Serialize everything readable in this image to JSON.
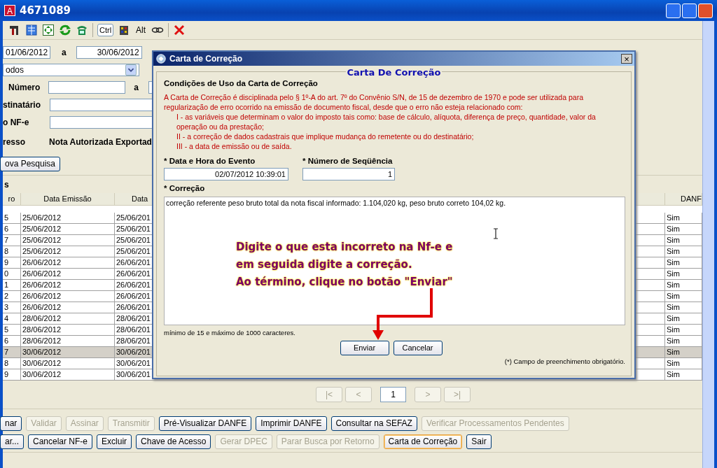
{
  "window": {
    "title": "4671089",
    "app_icon": "A"
  },
  "toolbar": {
    "keys": [
      "Ctrl",
      "Alt"
    ]
  },
  "filters": {
    "date_from": "01/06/2012",
    "date_sep": "a",
    "date_to": "30/06/2012",
    "select_value": "odos",
    "numero_label": "Número",
    "numero_sep": "a",
    "destinatario_label": "stinatário",
    "nfe_label": "o NF-e",
    "progress_label": "resso",
    "progress_value": "Nota Autorizada Exportad",
    "search_button": "ova Pesquisa"
  },
  "table": {
    "section_label": "s",
    "columns": [
      "ro",
      "Data Emissão",
      "Data",
      "DANF"
    ],
    "rows": [
      {
        "cells": [
          "5",
          "25/06/2012",
          "25/06/201",
          "Sim"
        ],
        "selected": false
      },
      {
        "cells": [
          "6",
          "25/06/2012",
          "25/06/201",
          "Sim"
        ],
        "selected": false
      },
      {
        "cells": [
          "7",
          "25/06/2012",
          "25/06/201",
          "Sim"
        ],
        "selected": false
      },
      {
        "cells": [
          "8",
          "25/06/2012",
          "25/06/201",
          "Sim"
        ],
        "selected": false
      },
      {
        "cells": [
          "9",
          "26/06/2012",
          "26/06/201",
          "Sim"
        ],
        "selected": false
      },
      {
        "cells": [
          "0",
          "26/06/2012",
          "26/06/201",
          "Sim"
        ],
        "selected": false
      },
      {
        "cells": [
          "1",
          "26/06/2012",
          "26/06/201",
          "Sim"
        ],
        "selected": false
      },
      {
        "cells": [
          "2",
          "26/06/2012",
          "26/06/201",
          "Sim"
        ],
        "selected": false
      },
      {
        "cells": [
          "3",
          "26/06/2012",
          "26/06/201",
          "Sim"
        ],
        "selected": false
      },
      {
        "cells": [
          "4",
          "28/06/2012",
          "28/06/201",
          "Sim"
        ],
        "selected": false
      },
      {
        "cells": [
          "5",
          "28/06/2012",
          "28/06/201",
          "Sim"
        ],
        "selected": false
      },
      {
        "cells": [
          "6",
          "28/06/2012",
          "28/06/201",
          "Sim"
        ],
        "selected": false
      },
      {
        "cells": [
          "7",
          "30/06/2012",
          "30/06/201",
          "Sim"
        ],
        "selected": true
      },
      {
        "cells": [
          "8",
          "30/06/2012",
          "30/06/201",
          "Sim"
        ],
        "selected": false
      },
      {
        "cells": [
          "9",
          "30/06/2012",
          "30/06/201",
          "Sim"
        ],
        "selected": false
      }
    ]
  },
  "pager": {
    "first": "|<",
    "prev": "<",
    "page": "1",
    "next": ">",
    "last": ">|"
  },
  "actions": [
    [
      {
        "label": "nar",
        "disabled": false,
        "focused": false
      },
      {
        "label": "Validar",
        "disabled": true,
        "focused": false
      },
      {
        "label": "Assinar",
        "disabled": true,
        "focused": false
      },
      {
        "label": "Transmitir",
        "disabled": true,
        "focused": false
      },
      {
        "label": "Pré-Visualizar DANFE",
        "disabled": false,
        "focused": false
      },
      {
        "label": "Imprimir DANFE",
        "disabled": false,
        "focused": false
      },
      {
        "label": "Consultar na SEFAZ",
        "disabled": false,
        "focused": false
      },
      {
        "label": "Verificar Processamentos Pendentes",
        "disabled": true,
        "focused": false
      }
    ],
    [
      {
        "label": "ar...",
        "disabled": false,
        "focused": false
      },
      {
        "label": "Cancelar NF-e",
        "disabled": false,
        "focused": false
      },
      {
        "label": "Excluir",
        "disabled": false,
        "focused": false
      },
      {
        "label": "Chave de Acesso",
        "disabled": false,
        "focused": false
      },
      {
        "label": "Gerar DPEC",
        "disabled": true,
        "focused": false
      },
      {
        "label": "Parar Busca por Retorno",
        "disabled": true,
        "focused": false
      },
      {
        "label": "Carta de Correção",
        "disabled": false,
        "focused": true
      },
      {
        "label": "Sair",
        "disabled": false,
        "focused": false
      }
    ]
  ],
  "dialog": {
    "title": "Carta de Correção",
    "close": "×",
    "legend": "Carta De Correção",
    "heading": "Condições de Uso da Carta de Correção",
    "intro": "A Carta de Correção é disciplinada pelo § 1º-A do art. 7º do Convênio S/N, de 15 de dezembro de 1970 e pode ser utilizada para regularização de erro ocorrido na emissão de documento fiscal, desde que o erro não esteja relacionado com:",
    "items": [
      "I - as variáveis que determinam o valor do imposto tais como: base de cálculo, alíquota, diferença de preço, quantidade, valor da operação ou da prestação;",
      "II - a correção de dados cadastrais que implique mudança do remetente ou do destinatário;",
      "III - a data de emissão ou de saída."
    ],
    "event_label": "* Data e Hora do Evento",
    "event_value": "02/07/2012 10:39:01",
    "seq_label": "* Número de Seqüência",
    "seq_value": "1",
    "correction_label": "* Correção",
    "correction_value": "correção referente  peso bruto total da nota fiscal  informado: 1.104,020 kg, peso bruto correto   104,02 kg.",
    "hint": "mínimo de 15 e máximo de 1000 caracteres.",
    "buttons": [
      "Enviar",
      "Cancelar"
    ],
    "footnote": "(*) Campo de preenchimento obrigatório."
  },
  "annotation": {
    "lines": [
      "Digite o que esta incorreto na Nf-e e",
      "em seguida digite a correção.",
      "Ao término, clique no botão \"Enviar\""
    ]
  }
}
